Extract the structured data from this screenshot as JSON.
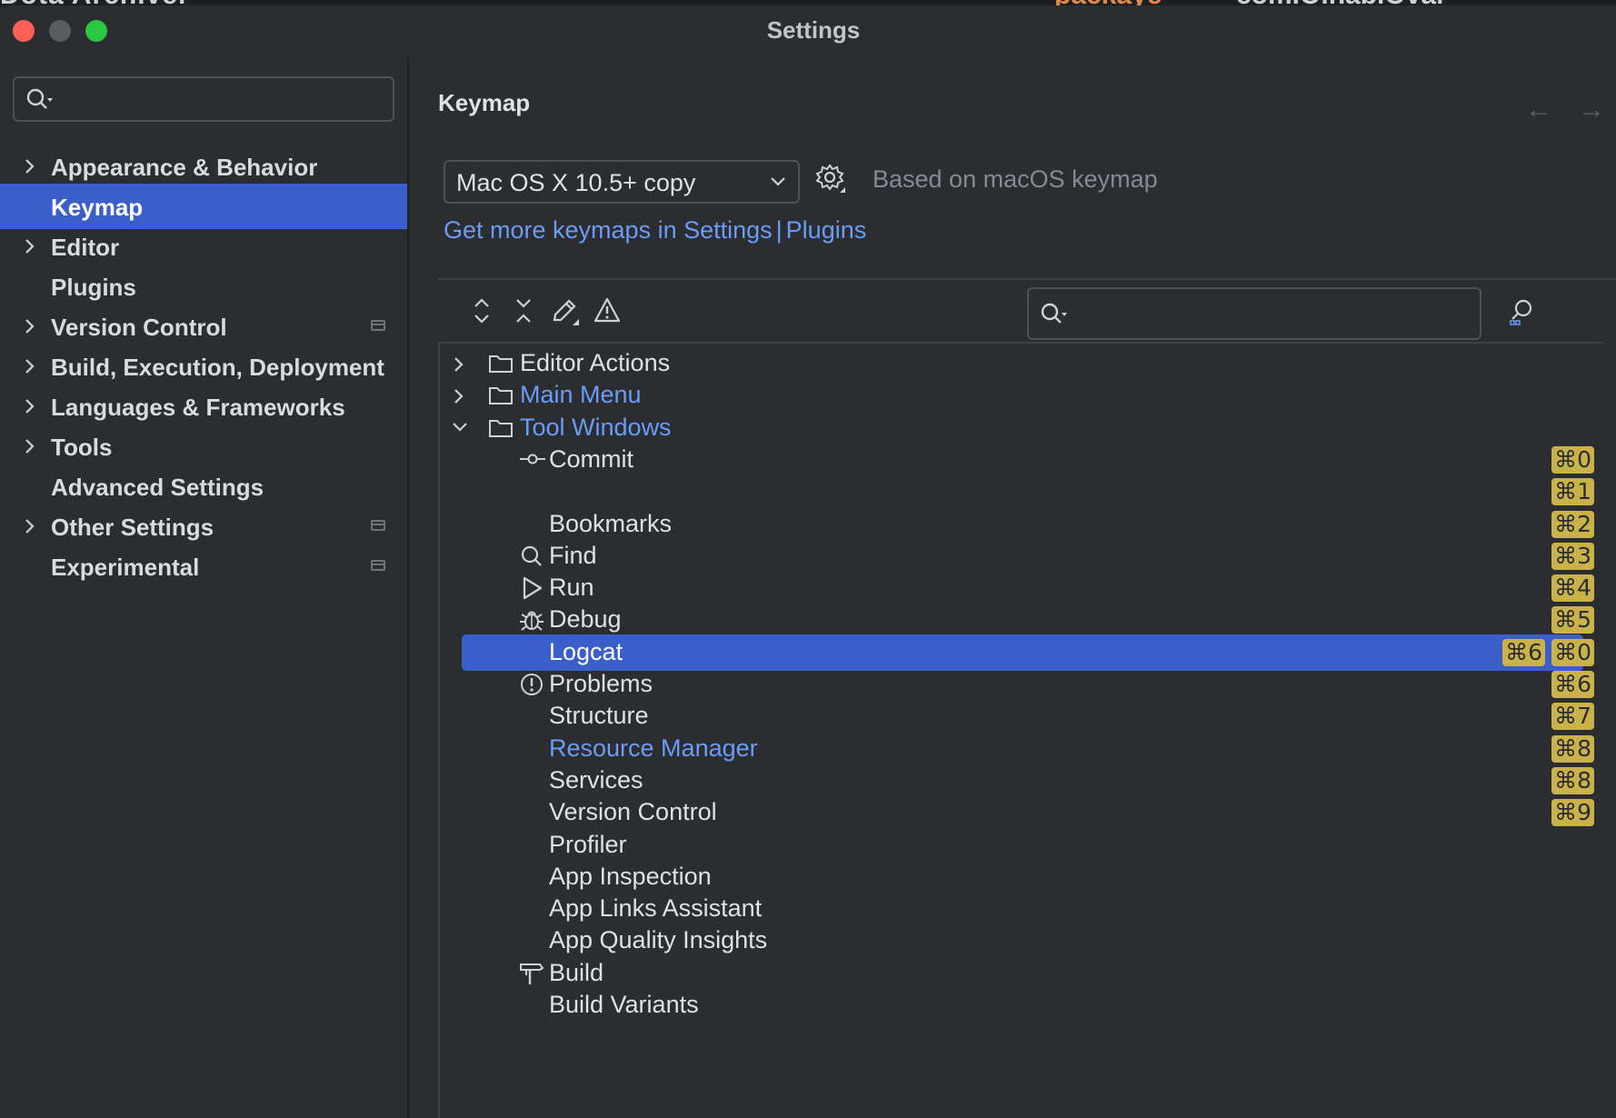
{
  "background_strip": {
    "left": "Dota Archiver",
    "middle": "packaye",
    "right": "com.Olhab.Oval"
  },
  "window": {
    "title": "Settings"
  },
  "sidebar": {
    "search_placeholder": "",
    "items": [
      {
        "label": "Appearance & Behavior",
        "expandable": true,
        "selected": false,
        "badge": false
      },
      {
        "label": "Keymap",
        "expandable": false,
        "selected": true,
        "badge": false
      },
      {
        "label": "Editor",
        "expandable": true,
        "selected": false,
        "badge": false
      },
      {
        "label": "Plugins",
        "expandable": false,
        "selected": false,
        "badge": false
      },
      {
        "label": "Version Control",
        "expandable": true,
        "selected": false,
        "badge": true
      },
      {
        "label": "Build, Execution, Deployment",
        "expandable": true,
        "selected": false,
        "badge": false
      },
      {
        "label": "Languages & Frameworks",
        "expandable": true,
        "selected": false,
        "badge": false
      },
      {
        "label": "Tools",
        "expandable": true,
        "selected": false,
        "badge": false
      },
      {
        "label": "Advanced Settings",
        "expandable": false,
        "selected": false,
        "badge": false
      },
      {
        "label": "Other Settings",
        "expandable": true,
        "selected": false,
        "badge": true
      },
      {
        "label": "Experimental",
        "expandable": false,
        "selected": false,
        "badge": true
      }
    ]
  },
  "main": {
    "title": "Keymap",
    "back_arrow": "←",
    "forward_arrow": "→",
    "keymap_select": {
      "value": "Mac OS X 10.5+ copy"
    },
    "based_on": "Based on macOS keymap",
    "link_get_more": "Get more keymaps in Settings",
    "link_separator": "|",
    "link_plugins": "Plugins",
    "search_placeholder": "",
    "toolbar_icons": [
      "expand-all-icon",
      "collapse-all-icon",
      "edit-shortcut-icon",
      "conflicts-warning-icon"
    ],
    "tree": [
      {
        "label": "Editor Actions",
        "level": 0,
        "chevron": "right",
        "icon": "folder",
        "modified": false
      },
      {
        "label": "Main Menu",
        "level": 0,
        "chevron": "right",
        "icon": "folder",
        "modified": true
      },
      {
        "label": "Tool Windows",
        "level": 0,
        "chevron": "down",
        "icon": "folder",
        "modified": true
      },
      {
        "label": "Commit",
        "level": 1,
        "icon": "commit",
        "shortcuts": [
          "⌘0"
        ]
      },
      {
        "label": "",
        "level": 1,
        "icon": "",
        "shortcuts": [
          "⌘1"
        ]
      },
      {
        "label": "Bookmarks",
        "level": 1,
        "icon": "",
        "shortcuts": [
          "⌘2"
        ]
      },
      {
        "label": "Find",
        "level": 1,
        "icon": "search",
        "shortcuts": [
          "⌘3"
        ]
      },
      {
        "label": "Run",
        "level": 1,
        "icon": "run",
        "shortcuts": [
          "⌘4"
        ]
      },
      {
        "label": "Debug",
        "level": 1,
        "icon": "debug",
        "shortcuts": [
          "⌘5"
        ]
      },
      {
        "label": "Logcat",
        "level": 1,
        "icon": "",
        "selected": true,
        "shortcuts": [
          "⌘6",
          "⌘0"
        ]
      },
      {
        "label": "Problems",
        "level": 1,
        "icon": "problems",
        "shortcuts": [
          "⌘6"
        ]
      },
      {
        "label": "Structure",
        "level": 1,
        "icon": "",
        "shortcuts": [
          "⌘7"
        ]
      },
      {
        "label": "Resource Manager",
        "level": 1,
        "icon": "",
        "modified": true,
        "shortcuts": [
          "⌘8"
        ]
      },
      {
        "label": "Services",
        "level": 1,
        "icon": "",
        "shortcuts": [
          "⌘8"
        ]
      },
      {
        "label": "Version Control",
        "level": 1,
        "icon": "",
        "shortcuts": [
          "⌘9"
        ]
      },
      {
        "label": "Profiler",
        "level": 1,
        "icon": "",
        "shortcuts": []
      },
      {
        "label": "App Inspection",
        "level": 1,
        "icon": "",
        "shortcuts": []
      },
      {
        "label": "App Links Assistant",
        "level": 1,
        "icon": "",
        "shortcuts": []
      },
      {
        "label": "App Quality Insights",
        "level": 1,
        "icon": "",
        "shortcuts": []
      },
      {
        "label": "Build",
        "level": 1,
        "icon": "build",
        "shortcuts": []
      },
      {
        "label": "Build Variants",
        "level": 1,
        "icon": "",
        "shortcuts": []
      }
    ]
  },
  "colors": {
    "accent": "#3a5fc8",
    "link": "#6b9cf5",
    "shortcut_bg": "#c9b24a",
    "background": "#2b2d30"
  }
}
